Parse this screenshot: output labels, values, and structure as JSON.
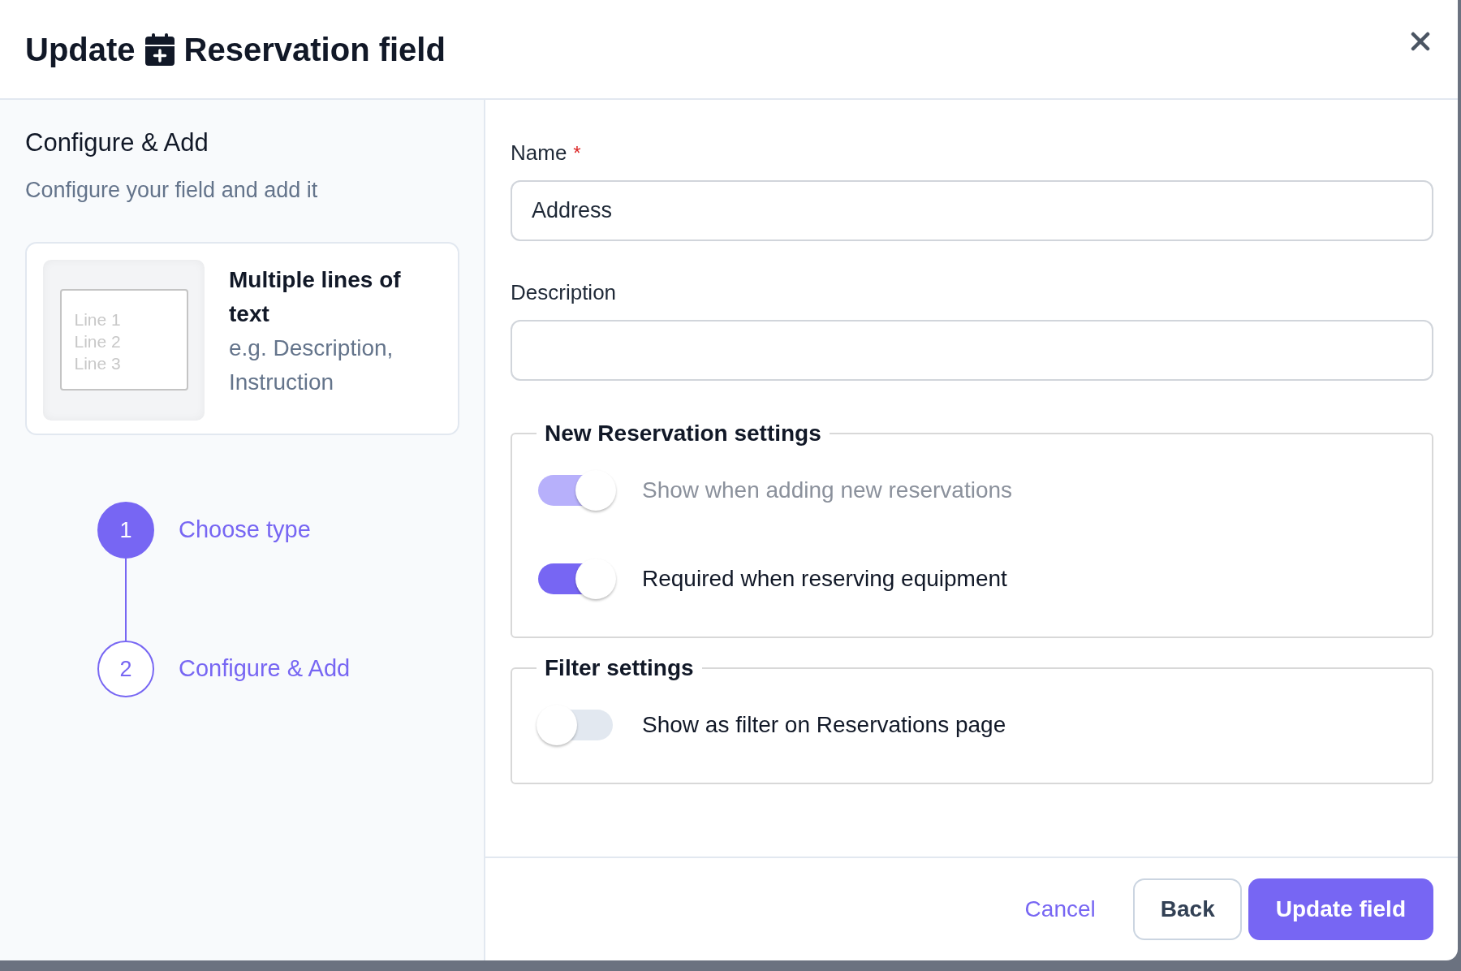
{
  "dialog": {
    "title_before": "Update",
    "title_after": "Reservation field"
  },
  "sidebar": {
    "heading": "Configure & Add",
    "subheading": "Configure your field and add it",
    "field_type": {
      "preview_lines": [
        "Line 1",
        "Line 2",
        "Line 3"
      ],
      "name": "Multiple lines of text",
      "example": "e.g. Description, Instruction"
    },
    "steps": [
      {
        "number": "1",
        "label": "Choose type",
        "completed": true
      },
      {
        "number": "2",
        "label": "Configure & Add",
        "completed": false
      }
    ]
  },
  "form": {
    "name": {
      "label": "Name",
      "required_mark": "*",
      "value": "Address"
    },
    "description": {
      "label": "Description"
    },
    "sections": [
      {
        "title": "New Reservation settings",
        "toggles": [
          {
            "label": "Show when adding new reservations",
            "on": true,
            "disabled": true
          },
          {
            "label": "Required when reserving equipment",
            "on": true,
            "disabled": false
          }
        ]
      },
      {
        "title": "Filter settings",
        "toggles": [
          {
            "label": "Show as filter on Reservations page",
            "on": false,
            "disabled": false
          }
        ]
      }
    ]
  },
  "buttons": [
    {
      "kind": "link",
      "label": "Cancel"
    },
    {
      "kind": "secondary",
      "label": "Back"
    },
    {
      "kind": "primary",
      "label": "Update field"
    }
  ]
}
